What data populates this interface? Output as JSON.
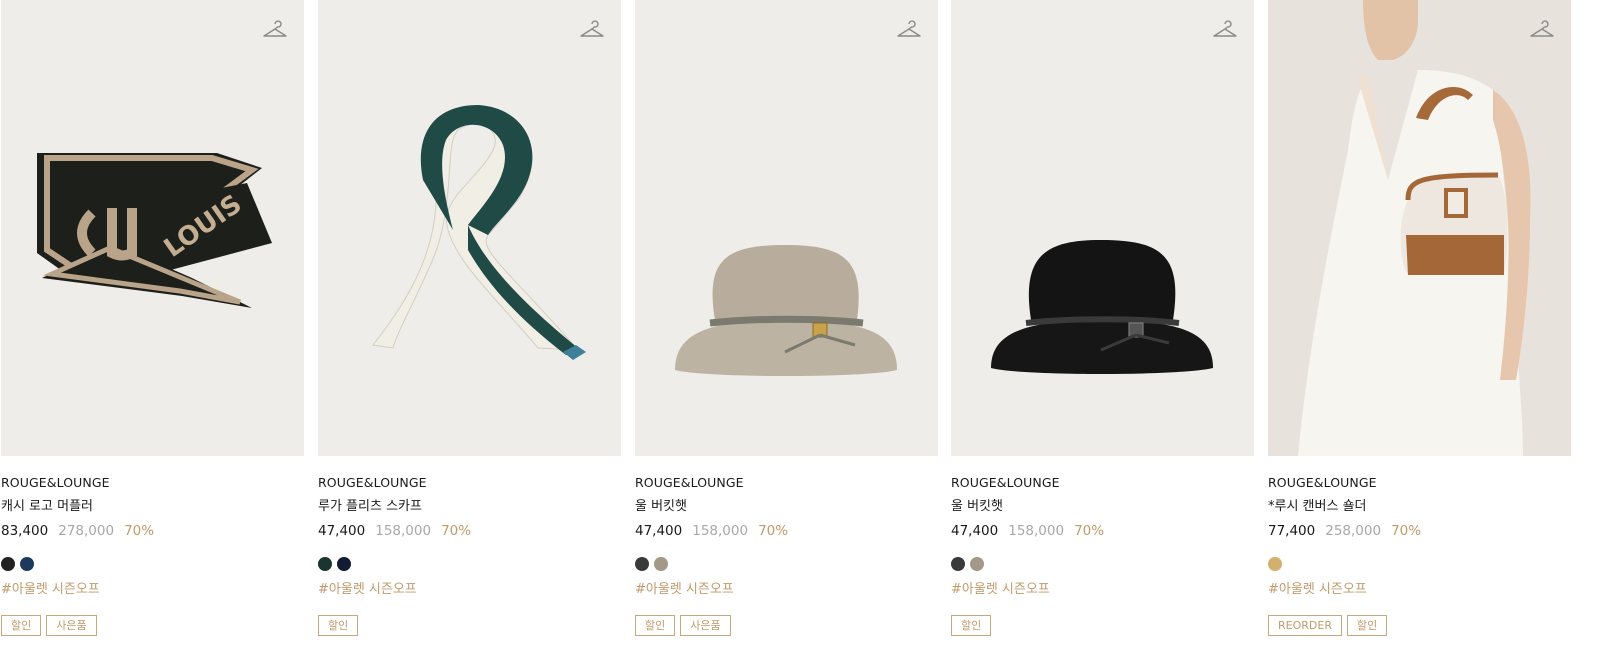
{
  "products": [
    {
      "brand": "ROUGE&LOUNGE",
      "name": "캐시 로고 머플러",
      "price": "83,400",
      "original_price": "278,000",
      "discount": "70%",
      "swatches": [
        "#222222",
        "#1d3a5c"
      ],
      "hashtag": "#아울렛 시즌오프",
      "tags": [
        "할인",
        "사은품"
      ],
      "image": "muffler-icon"
    },
    {
      "brand": "ROUGE&LOUNGE",
      "name": "루가 플리츠 스카프",
      "price": "47,400",
      "original_price": "158,000",
      "discount": "70%",
      "swatches": [
        "#1b3430",
        "#121c33"
      ],
      "hashtag": "#아울렛 시즌오프",
      "tags": [
        "할인"
      ],
      "image": "scarf-icon"
    },
    {
      "brand": "ROUGE&LOUNGE",
      "name": "울 버킷햇",
      "price": "47,400",
      "original_price": "158,000",
      "discount": "70%",
      "swatches": [
        "#3a3a3a",
        "#a39889"
      ],
      "hashtag": "#아울렛 시즌오프",
      "tags": [
        "할인",
        "사은품"
      ],
      "image": "beige-hat-icon"
    },
    {
      "brand": "ROUGE&LOUNGE",
      "name": "울 버킷햇",
      "price": "47,400",
      "original_price": "158,000",
      "discount": "70%",
      "swatches": [
        "#3a3a3a",
        "#a39889"
      ],
      "hashtag": "#아울렛 시즌오프",
      "tags": [
        "할인"
      ],
      "image": "black-hat-icon"
    },
    {
      "brand": "ROUGE&LOUNGE",
      "name": "*루시 캔버스 숄더",
      "price": "77,400",
      "original_price": "258,000",
      "discount": "70%",
      "swatches": [
        "#d2b06f"
      ],
      "hashtag": "#아울렛 시즌오프",
      "tags": [
        "REORDER",
        "할인"
      ],
      "image": "model-bag-icon"
    }
  ],
  "icons": {
    "wishlist": "hanger-icon"
  },
  "colors": {
    "accent": "#c19a6b",
    "original_price": "#a8a8a8",
    "thumb_bg": "#eeede9"
  }
}
